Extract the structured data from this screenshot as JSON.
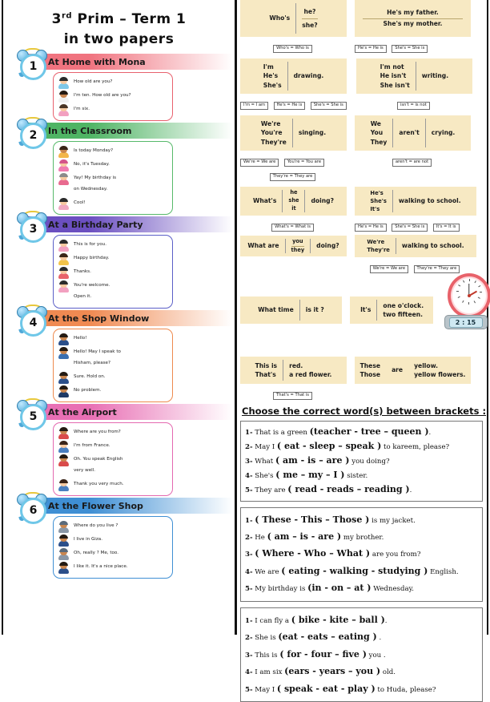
{
  "title": {
    "line1_pre": "3",
    "line1_sup": "rd",
    "line1_post": " Prim – Term 1",
    "line2": "in two papers"
  },
  "left_sections": [
    {
      "number": "1",
      "title": "At Home with Mona",
      "accent": "#e8616e",
      "header_color": "#f0737f",
      "lines": [
        {
          "text": "How old are you?",
          "skin": "#f6c9a0",
          "hair": "#2b2b2b",
          "shirt": "#7fc8e8"
        },
        {
          "text": "I'm ten. How old are you?",
          "skin": "#c9864f",
          "hair": "#241a12",
          "shirt": "#f0f0f0"
        },
        {
          "text": "I'm six.",
          "skin": "#f6c9a0",
          "hair": "#4a3524",
          "shirt": "#f2a0c0"
        }
      ]
    },
    {
      "number": "2",
      "title": "In the Classroom",
      "accent": "#57b96a",
      "header_color": "#4fb464",
      "lines": [
        {
          "text": "Is today Monday?",
          "skin": "#c9864f",
          "hair": "#3a2418",
          "shirt": "#f3b64a"
        },
        {
          "text": "No, it's Tuesday.",
          "skin": "#f6c9a0",
          "hair": "#d4548a",
          "shirt": "#f07bb0"
        },
        {
          "text": "Yay! My birthday is",
          "skin": "#f6c9a0",
          "hair": "#8a8a8a",
          "shirt": "#e86a8f"
        },
        {
          "text": "on Wednesday.",
          "skin": "#f6c9a0",
          "hair": "#8a8a8a",
          "shirt": "#e86a8f",
          "cont": true
        },
        {
          "text": "Cool!",
          "skin": "#f6c9a0",
          "hair": "#2b2b2b",
          "shirt": "#f0a8c0"
        }
      ]
    },
    {
      "number": "3",
      "title": "At a Birthday Party",
      "accent": "#5b5fc7",
      "header_color": "#6b4fc0",
      "lines": [
        {
          "text": "This is for you.",
          "skin": "#f6c9a0",
          "hair": "#2b2b2b",
          "shirt": "#f2a0c0"
        },
        {
          "text": "Happy birthday.",
          "skin": "#f6c9a0",
          "hair": "#3a2418",
          "shirt": "#f3c44a"
        },
        {
          "text": "Thanks.",
          "skin": "#f6c9a0",
          "hair": "#2b2b2b",
          "shirt": "#e8626a"
        },
        {
          "text": "You're welcome.",
          "skin": "#f6c9a0",
          "hair": "#2b2b2b",
          "shirt": "#f2a0c0"
        },
        {
          "text": "Open it.",
          "skin": "#f6c9a0",
          "hair": "#2b2b2b",
          "shirt": "#f2a0c0",
          "cont": true
        }
      ]
    },
    {
      "number": "4",
      "title": "At the Shop Window",
      "accent": "#ee8a4e",
      "header_color": "#f08a52",
      "lines": [
        {
          "text": "Hello!",
          "skin": "#c9864f",
          "hair": "#241a12",
          "shirt": "#2b4f8a"
        },
        {
          "text": "Hello! May I speak to",
          "skin": "#c9864f",
          "hair": "#241a12",
          "shirt": "#3b6fb0"
        },
        {
          "text": "Hisham, please?",
          "skin": "#c9864f",
          "hair": "#241a12",
          "shirt": "#3b6fb0",
          "cont": true
        },
        {
          "text": "Sure. Hold on.",
          "skin": "#c9864f",
          "hair": "#241a12",
          "shirt": "#2b4f8a"
        },
        {
          "text": "No problem.",
          "skin": "#c9864f",
          "hair": "#241a12",
          "shirt": "#1e3a66"
        }
      ]
    },
    {
      "number": "5",
      "title": "At the Airport",
      "accent": "#e469b0",
      "header_color": "#e86fb4",
      "lines": [
        {
          "text": "Where are you from?",
          "skin": "#c9864f",
          "hair": "#241a12",
          "shirt": "#d94b4b"
        },
        {
          "text": "I'm from France.",
          "skin": "#f6c9a0",
          "hair": "#3a2418",
          "shirt": "#4a7fc0"
        },
        {
          "text": "Oh. You speak English",
          "skin": "#c9864f",
          "hair": "#241a12",
          "shirt": "#d94b4b"
        },
        {
          "text": "very well.",
          "skin": "#c9864f",
          "hair": "#241a12",
          "shirt": "#d94b4b",
          "cont": true
        },
        {
          "text": "Thank you very much.",
          "skin": "#f6c9a0",
          "hair": "#3a2418",
          "shirt": "#4a7fc0"
        }
      ]
    },
    {
      "number": "6",
      "title": "At the Flower Shop",
      "accent": "#3f8fd4",
      "header_color": "#3f8fd4",
      "lines": [
        {
          "text": "Where do you live ?",
          "skin": "#c9864f",
          "hair": "#5a6a7a",
          "shirt": "#8a97a6"
        },
        {
          "text": "I live in Giza.",
          "skin": "#c9864f",
          "hair": "#241a12",
          "shirt": "#2b4f8a"
        },
        {
          "text": "Oh, really ? Me, too.",
          "skin": "#c9864f",
          "hair": "#5a6a7a",
          "shirt": "#8a97a6"
        },
        {
          "text": "I like it. It's a nice place.",
          "skin": "#c9864f",
          "hair": "#241a12",
          "shirt": "#2b4f8a"
        }
      ]
    }
  ],
  "grammar": {
    "box1": {
      "left": "Who's",
      "right_top": "he?",
      "right_bottom": "she?",
      "notes": [
        "Who's = Who is"
      ]
    },
    "box2": {
      "line1": "He's my father.",
      "line2": "She's my mother.",
      "notes": [
        "He's = He is",
        "She's = She is"
      ]
    },
    "box3": {
      "stack": [
        "I'm",
        "He's",
        "She's"
      ],
      "right": "drawing.",
      "notes": [
        "I'm = I am",
        "He's = He is",
        "She's = She is"
      ]
    },
    "box4": {
      "stack": [
        "I'm not",
        "He isn't",
        "She isn't"
      ],
      "right": "writing.",
      "notes": [
        "isn't = is not"
      ]
    },
    "box5": {
      "stack": [
        "We're",
        "You're",
        "They're"
      ],
      "right": "singing.",
      "notes": [
        "We're = We are",
        "You're = You are",
        "They're = They are"
      ]
    },
    "box6": {
      "stack": [
        "We",
        "You",
        "They"
      ],
      "mid": "aren't",
      "right": "crying.",
      "notes": [
        "aren't = are not"
      ]
    },
    "box7": {
      "left": "What's",
      "stack": [
        "he",
        "she",
        "it"
      ],
      "right": "doing?",
      "notes": [
        "What's = What is"
      ]
    },
    "box8": {
      "stack": [
        "He's",
        "She's",
        "It's"
      ],
      "right": "walking to school.",
      "notes": [
        "He's = He is",
        "She's = She is",
        "It's = It is"
      ]
    },
    "box9": {
      "left": "What are",
      "stack": [
        "you",
        "they"
      ],
      "right": "doing?",
      "notes": []
    },
    "box10": {
      "stack": [
        "We're",
        "They're"
      ],
      "right": "walking to school.",
      "notes": [
        "We're = We are",
        "They're = They are"
      ]
    },
    "box11": {
      "left": "What time",
      "right": "is it ?",
      "notes": []
    },
    "box12": {
      "left": "It's",
      "right_top": "one o'clock.",
      "right_bottom": "two fifteen.",
      "notes": []
    },
    "box13": {
      "stack": [
        "This is",
        "That's"
      ],
      "right_stack": [
        "red.",
        "a red flower."
      ],
      "notes": [
        "That's = That is"
      ]
    },
    "box14": {
      "stack": [
        "These",
        "Those"
      ],
      "mid": "are",
      "right_stack": [
        "yellow.",
        "yellow flowers."
      ],
      "notes": []
    }
  },
  "clock": {
    "digital_time": "2 : 15",
    "analog_label": "two fifteen"
  },
  "exercises": {
    "heading": "Choose the correct word(s) between brackets :",
    "boxes": [
      {
        "items": [
          {
            "num": "1-",
            "pre": " That is a green ",
            "choice": "(teacher - tree – queen )",
            "post": "."
          },
          {
            "num": "2-",
            "pre": " May I  ",
            "choice": "( eat - sleep – speak )",
            "post": " to kareem, please?"
          },
          {
            "num": "3-",
            "pre": " What ",
            "choice": "( am - is – are )",
            "post": " you doing?"
          },
          {
            "num": "4-",
            "pre": " She's ",
            "choice": "( me – my – I )",
            "post": " sister."
          },
          {
            "num": "5-",
            "pre": " They are ",
            "choice": "( read - reads – reading )",
            "post": "."
          }
        ]
      },
      {
        "items": [
          {
            "num": "1-",
            "pre": " ",
            "choice": "( These  - This – Those )",
            "post": " is my jacket."
          },
          {
            "num": "2-",
            "pre": " He ",
            "choice": "( am – is  - are )",
            "post": " my brother."
          },
          {
            "num": "3-",
            "pre": " ",
            "choice": "( Where  - Who – What )",
            "post": " are you from?"
          },
          {
            "num": "4-",
            "pre": " We are  ",
            "choice": "( eating  - walking  - studying )",
            "post": "  English."
          },
          {
            "num": "5-",
            "pre": " My birthday is  ",
            "choice": "(in - on – at )",
            "post": "  Wednesday."
          }
        ]
      },
      {
        "items": [
          {
            "num": "1-",
            "pre": " I can fly a ",
            "choice": "( bike - kite – ball )",
            "post": "."
          },
          {
            "num": "2-",
            "pre": " She is ",
            "choice": "(eat - eats – eating )",
            "post": " ."
          },
          {
            "num": "3-",
            "pre": " This is  ",
            "choice": "( for - four – five )",
            "post": " you ."
          },
          {
            "num": "4-",
            "pre": " I am six ",
            "choice": "(ears  - years – you )",
            "post": " old."
          },
          {
            "num": "5-",
            "pre": " May I ",
            "choice": "( speak  - eat  - play )",
            "post": " to Huda, please?"
          }
        ]
      }
    ]
  }
}
